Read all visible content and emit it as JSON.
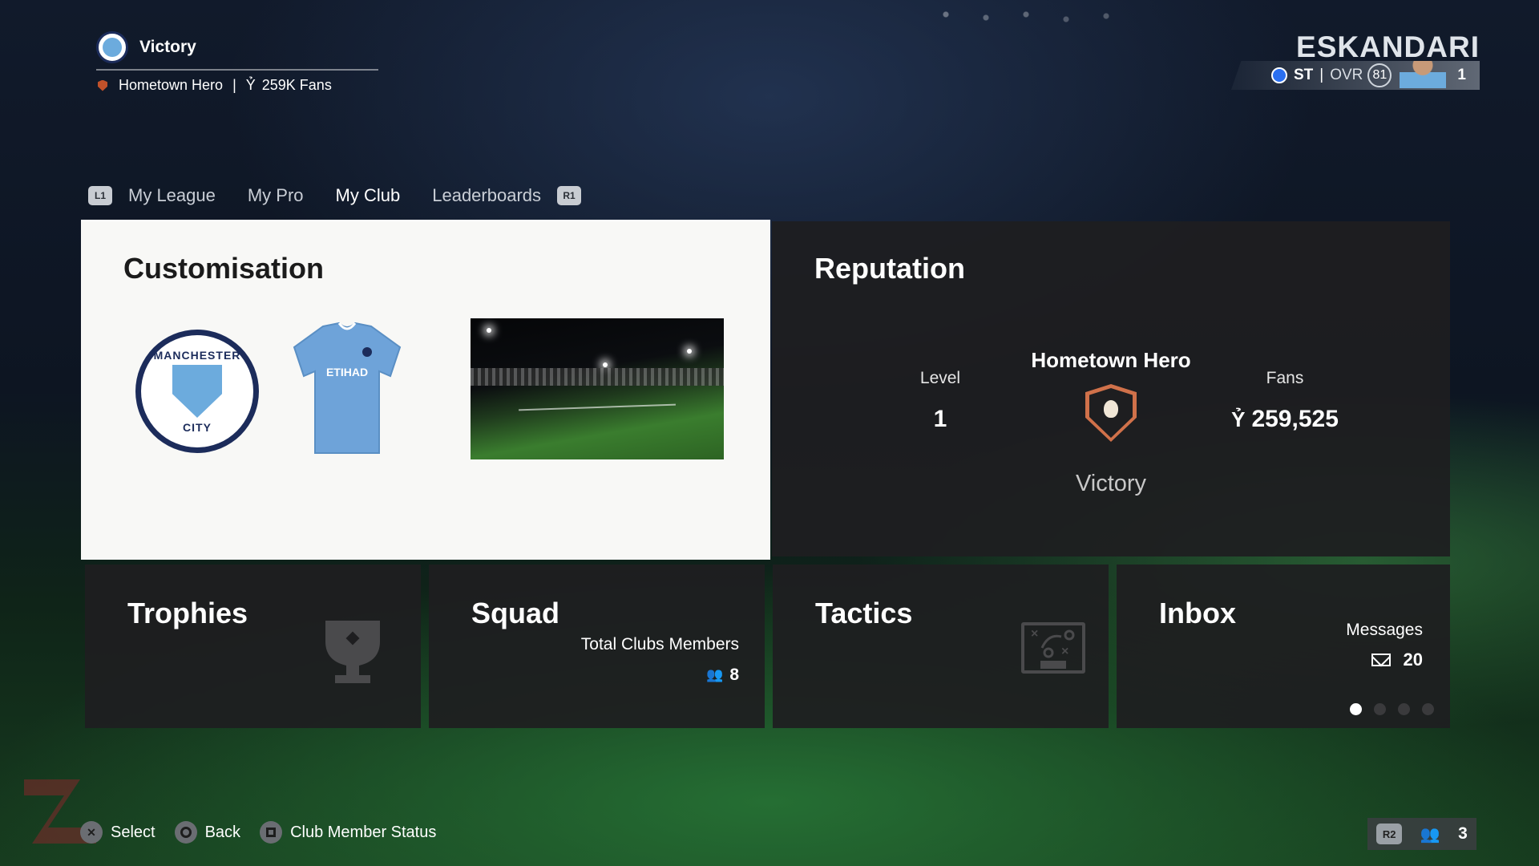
{
  "header": {
    "club_name": "Victory",
    "reputation_tier": "Hometown Hero",
    "separator": "|",
    "fans_short": "259K Fans"
  },
  "player": {
    "name": "ESKANDARI",
    "position": "ST",
    "separator": "|",
    "ovr_label": "OVR",
    "ovr_value": "81",
    "count": "1"
  },
  "tabs": {
    "left_shoulder": "L1",
    "right_shoulder": "R1",
    "items": [
      {
        "label": "My League",
        "active": false
      },
      {
        "label": "My Pro",
        "active": false
      },
      {
        "label": "My Club",
        "active": true
      },
      {
        "label": "Leaderboards",
        "active": false
      }
    ]
  },
  "customisation": {
    "title": "Customisation",
    "crest_top": "MANCHESTER",
    "crest_bottom": "CITY",
    "kit_sponsor": "ETIHAD"
  },
  "reputation": {
    "title": "Reputation",
    "level_label": "Level",
    "level_value": "1",
    "tier_title": "Hometown Hero",
    "fans_label": "Fans",
    "fans_value": "259,525",
    "tier_name": "Victory"
  },
  "trophies": {
    "title": "Trophies"
  },
  "squad": {
    "title": "Squad",
    "members_label": "Total Clubs Members",
    "members_count": "8"
  },
  "tactics": {
    "title": "Tactics"
  },
  "inbox": {
    "title": "Inbox",
    "messages_label": "Messages",
    "messages_count": "20",
    "pages": 4,
    "current_page": 1
  },
  "footer": {
    "hints": [
      {
        "label": "Select",
        "button": "cross"
      },
      {
        "label": "Back",
        "button": "circle"
      },
      {
        "label": "Club Member Status",
        "button": "square"
      }
    ],
    "r2_label": "R2",
    "party_count": "3"
  },
  "colors": {
    "accent_blue": "#6cabdd",
    "card_dark": "#1e1e20",
    "card_light": "#f8f8f6",
    "badge_orange": "#d0714a"
  },
  "icons": {
    "club_crest": "manchester-city-crest-icon",
    "fans": "fans-icon",
    "trophy": "trophy-icon",
    "tactics": "tactics-board-icon",
    "members": "people-icon",
    "mail": "mail-icon"
  }
}
